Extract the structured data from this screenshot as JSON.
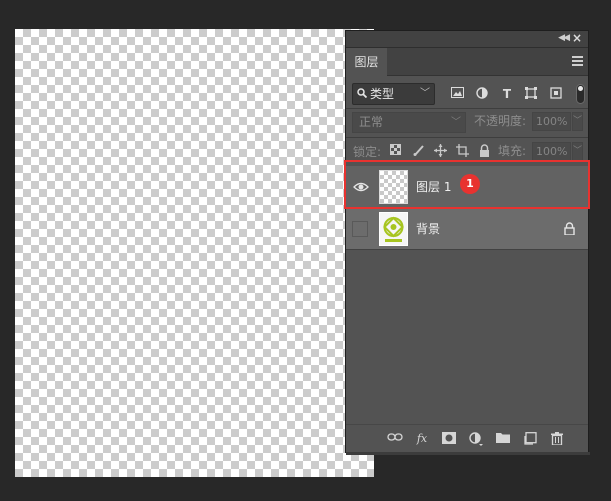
{
  "panel": {
    "tab_label": "图层",
    "filter": {
      "kind_label": "类型",
      "search_glyph": "🔍"
    },
    "blend": {
      "mode": "正常",
      "opacity_label": "不透明度:",
      "opacity_value": "100%"
    },
    "lock": {
      "label": "锁定:",
      "fill_label": "填充:",
      "fill_value": "100%"
    }
  },
  "layers": [
    {
      "name": "图层 1",
      "visible": true,
      "selected": true,
      "type": "transparent"
    },
    {
      "name": "背景",
      "visible": false,
      "selected": false,
      "type": "background",
      "locked": true
    }
  ],
  "annotation": {
    "badge_number": "1",
    "color": "#e8322f"
  },
  "colors": {
    "workspace": "#282828",
    "panel": "#535353",
    "selected_layer": "#626262"
  }
}
